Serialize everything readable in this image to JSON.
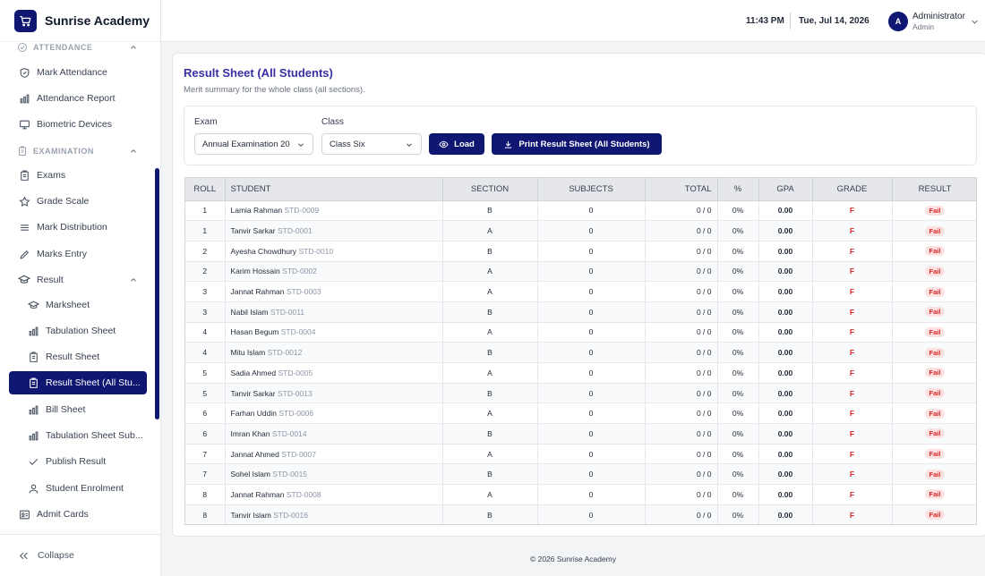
{
  "brand": {
    "name": "Sunrise Academy"
  },
  "sidebar": {
    "sections": [
      {
        "label": "ATTENDANCE",
        "icon": "shield-check-icon"
      },
      {
        "label": "EXAMINATION",
        "icon": "clipboard-icon"
      }
    ],
    "items": [
      {
        "label": "Mark Attendance",
        "icon": "shield-icon"
      },
      {
        "label": "Attendance Report",
        "icon": "bar-chart-icon"
      },
      {
        "label": "Biometric Devices",
        "icon": "monitor-icon"
      },
      {
        "label": "Exams",
        "icon": "clipboard-icon"
      },
      {
        "label": "Grade Scale",
        "icon": "star-icon"
      },
      {
        "label": "Mark Distribution",
        "icon": "list-icon"
      },
      {
        "label": "Marks Entry",
        "icon": "pencil-icon"
      },
      {
        "label": "Result",
        "icon": "graduation-cap-icon"
      },
      {
        "label": "Marksheet",
        "icon": "graduation-cap-icon"
      },
      {
        "label": "Tabulation Sheet",
        "icon": "bar-chart-icon"
      },
      {
        "label": "Result Sheet",
        "icon": "clipboard-icon"
      },
      {
        "label": "Result Sheet (All Stu...",
        "icon": "clipboard-icon"
      },
      {
        "label": "Bill Sheet",
        "icon": "bar-chart-icon"
      },
      {
        "label": "Tabulation Sheet Sub...",
        "icon": "bar-chart-icon"
      },
      {
        "label": "Publish Result",
        "icon": "check-icon"
      },
      {
        "label": "Student Enrolment",
        "icon": "user-icon"
      },
      {
        "label": "Admit Cards",
        "icon": "id-card-icon"
      }
    ],
    "collapse_label": "Collapse"
  },
  "header": {
    "time": "11:43 PM",
    "date": "Tue, Jul 14, 2026",
    "user_initial": "A",
    "user_name": "Administrator",
    "user_role": "Admin"
  },
  "page": {
    "title": "Result Sheet (All Students)",
    "subtitle": "Merit summary for the whole class (all sections)."
  },
  "filters": {
    "exam_label": "Exam",
    "exam_value": "Annual Examination 20",
    "class_label": "Class",
    "class_value": "Class Six",
    "load_label": "Load",
    "print_label": "Print Result Sheet (All Students)"
  },
  "table": {
    "headers": [
      "ROLL",
      "STUDENT",
      "SECTION",
      "SUBJECTS",
      "TOTAL",
      "%",
      "GPA",
      "GRADE",
      "RESULT"
    ],
    "rows": [
      {
        "roll": "1",
        "name": "Lamia Rahman",
        "id": "STD-0009",
        "section": "B",
        "subjects": "0",
        "total": "0 / 0",
        "percent": "0%",
        "gpa": "0.00",
        "grade": "F",
        "result": "Fail"
      },
      {
        "roll": "1",
        "name": "Tanvir Sarkar",
        "id": "STD-0001",
        "section": "A",
        "subjects": "0",
        "total": "0 / 0",
        "percent": "0%",
        "gpa": "0.00",
        "grade": "F",
        "result": "Fail"
      },
      {
        "roll": "2",
        "name": "Ayesha Chowdhury",
        "id": "STD-0010",
        "section": "B",
        "subjects": "0",
        "total": "0 / 0",
        "percent": "0%",
        "gpa": "0.00",
        "grade": "F",
        "result": "Fail"
      },
      {
        "roll": "2",
        "name": "Karim Hossain",
        "id": "STD-0002",
        "section": "A",
        "subjects": "0",
        "total": "0 / 0",
        "percent": "0%",
        "gpa": "0.00",
        "grade": "F",
        "result": "Fail"
      },
      {
        "roll": "3",
        "name": "Jannat Rahman",
        "id": "STD-0003",
        "section": "A",
        "subjects": "0",
        "total": "0 / 0",
        "percent": "0%",
        "gpa": "0.00",
        "grade": "F",
        "result": "Fail"
      },
      {
        "roll": "3",
        "name": "Nabil Islam",
        "id": "STD-0011",
        "section": "B",
        "subjects": "0",
        "total": "0 / 0",
        "percent": "0%",
        "gpa": "0.00",
        "grade": "F",
        "result": "Fail"
      },
      {
        "roll": "4",
        "name": "Hasan Begum",
        "id": "STD-0004",
        "section": "A",
        "subjects": "0",
        "total": "0 / 0",
        "percent": "0%",
        "gpa": "0.00",
        "grade": "F",
        "result": "Fail"
      },
      {
        "roll": "4",
        "name": "Mitu Islam",
        "id": "STD-0012",
        "section": "B",
        "subjects": "0",
        "total": "0 / 0",
        "percent": "0%",
        "gpa": "0.00",
        "grade": "F",
        "result": "Fail"
      },
      {
        "roll": "5",
        "name": "Sadia Ahmed",
        "id": "STD-0005",
        "section": "A",
        "subjects": "0",
        "total": "0 / 0",
        "percent": "0%",
        "gpa": "0.00",
        "grade": "F",
        "result": "Fail"
      },
      {
        "roll": "5",
        "name": "Tanvir Sarkar",
        "id": "STD-0013",
        "section": "B",
        "subjects": "0",
        "total": "0 / 0",
        "percent": "0%",
        "gpa": "0.00",
        "grade": "F",
        "result": "Fail"
      },
      {
        "roll": "6",
        "name": "Farhan Uddin",
        "id": "STD-0006",
        "section": "A",
        "subjects": "0",
        "total": "0 / 0",
        "percent": "0%",
        "gpa": "0.00",
        "grade": "F",
        "result": "Fail"
      },
      {
        "roll": "6",
        "name": "Imran Khan",
        "id": "STD-0014",
        "section": "B",
        "subjects": "0",
        "total": "0 / 0",
        "percent": "0%",
        "gpa": "0.00",
        "grade": "F",
        "result": "Fail"
      },
      {
        "roll": "7",
        "name": "Jannat Ahmed",
        "id": "STD-0007",
        "section": "A",
        "subjects": "0",
        "total": "0 / 0",
        "percent": "0%",
        "gpa": "0.00",
        "grade": "F",
        "result": "Fail"
      },
      {
        "roll": "7",
        "name": "Sohel Islam",
        "id": "STD-0015",
        "section": "B",
        "subjects": "0",
        "total": "0 / 0",
        "percent": "0%",
        "gpa": "0.00",
        "grade": "F",
        "result": "Fail"
      },
      {
        "roll": "8",
        "name": "Jannat Rahman",
        "id": "STD-0008",
        "section": "A",
        "subjects": "0",
        "total": "0 / 0",
        "percent": "0%",
        "gpa": "0.00",
        "grade": "F",
        "result": "Fail"
      },
      {
        "roll": "8",
        "name": "Tanvir Islam",
        "id": "STD-0016",
        "section": "B",
        "subjects": "0",
        "total": "0 / 0",
        "percent": "0%",
        "gpa": "0.00",
        "grade": "F",
        "result": "Fail"
      }
    ]
  },
  "footer": {
    "text": "© 2026 Sunrise Academy"
  },
  "colors": {
    "primary": "#0f1773",
    "title": "#3730a3",
    "fail": "#dc2626",
    "fail_bg": "#fee2e2"
  }
}
